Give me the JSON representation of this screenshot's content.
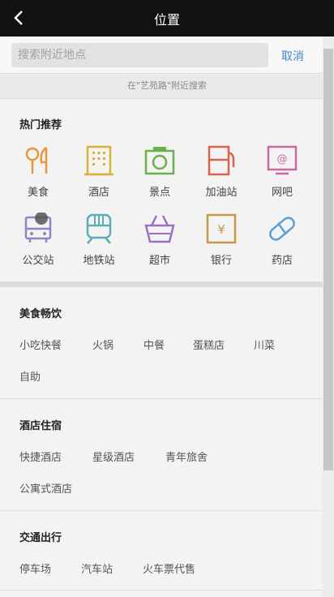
{
  "header": {
    "title": "位置",
    "back_icon": "chevron-left-icon"
  },
  "search": {
    "placeholder": "搜索附近地点",
    "cancel_label": "取消"
  },
  "hint": "在\"艺苑路\"附近搜索",
  "hot": {
    "title": "热门推荐",
    "items": [
      {
        "label": "美食",
        "icon": "food-icon",
        "color": "#e8963a"
      },
      {
        "label": "酒店",
        "icon": "hotel-icon",
        "color": "#d9b23d"
      },
      {
        "label": "景点",
        "icon": "scenery-icon",
        "color": "#6ab04c"
      },
      {
        "label": "加油站",
        "icon": "gas-station-icon",
        "color": "#d9624f"
      },
      {
        "label": "网吧",
        "icon": "internet-cafe-icon",
        "color": "#c969a6"
      },
      {
        "label": "公交站",
        "icon": "bus-stop-icon",
        "color": "#8a86c9"
      },
      {
        "label": "地铁站",
        "icon": "subway-icon",
        "color": "#5aaeb5"
      },
      {
        "label": "超市",
        "icon": "supermarket-icon",
        "color": "#9b6fc4"
      },
      {
        "label": "银行",
        "icon": "bank-icon",
        "color": "#c59a4a"
      },
      {
        "label": "药店",
        "icon": "pharmacy-icon",
        "color": "#5aa0d6"
      }
    ]
  },
  "food": {
    "title": "美食畅饮",
    "tags": [
      "小吃快餐",
      "火锅",
      "中餐",
      "蛋糕店",
      "川菜",
      "自助"
    ]
  },
  "hotel": {
    "title": "酒店住宿",
    "tags": [
      "快捷酒店",
      "星级酒店",
      "青年旅舍",
      "公寓式酒店"
    ]
  },
  "traffic": {
    "title": "交通出行",
    "tags": [
      "停车场",
      "汽车站",
      "火车票代售"
    ]
  }
}
